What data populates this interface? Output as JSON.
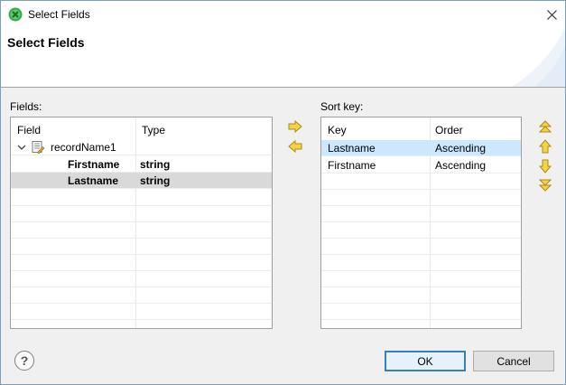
{
  "window": {
    "title": "Select Fields",
    "close_icon": "close-icon"
  },
  "banner": {
    "title": "Select Fields"
  },
  "fields_panel": {
    "label": "Fields:",
    "columns": [
      "Field",
      "Type"
    ],
    "tree": {
      "record": "recordName1",
      "items": [
        {
          "field": "Firstname",
          "type": "string"
        },
        {
          "field": "Lastname",
          "type": "string",
          "selected": true
        }
      ]
    }
  },
  "sort_panel": {
    "label": "Sort key:",
    "columns": [
      "Key",
      "Order"
    ],
    "rows": [
      {
        "key": "Lastname",
        "order": "Ascending",
        "selected": true
      },
      {
        "key": "Firstname",
        "order": "Ascending"
      }
    ]
  },
  "move_buttons": [
    "arrow-right-icon",
    "arrow-left-icon"
  ],
  "order_buttons": [
    "move-top-icon",
    "move-up-icon",
    "move-down-icon",
    "move-bottom-icon"
  ],
  "footer": {
    "help": "?",
    "ok": "OK",
    "cancel": "Cancel"
  },
  "colors": {
    "accent_arrow": "#f0c020",
    "selection_blue": "#cce8ff",
    "selection_grey": "#d9d9d9"
  }
}
